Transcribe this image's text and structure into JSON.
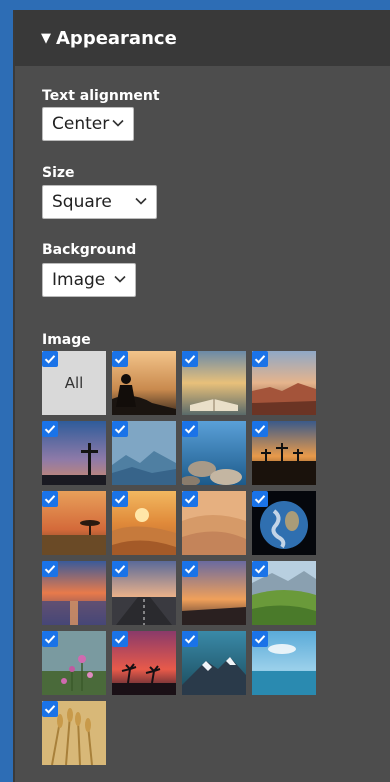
{
  "section": {
    "title": "Appearance"
  },
  "text_alignment": {
    "label": "Text alignment",
    "value": "Center"
  },
  "size": {
    "label": "Size",
    "value": "Square"
  },
  "background": {
    "label": "Background",
    "value": "Image"
  },
  "image": {
    "label": "Image",
    "all_label": "All",
    "tiles": [
      "person-reading-sunset",
      "open-book-lake",
      "red-rock-canyon",
      "cross-dusk",
      "misty-mountains",
      "rocky-coast",
      "three-crosses-sunset",
      "tree-savanna-sunset",
      "desert-dunes-sun",
      "desert-dunes",
      "earth-globe",
      "ocean-sunset",
      "road-horizon",
      "sunset-sky",
      "green-hills",
      "wildflowers",
      "palm-trees-sunset",
      "snowy-mountain",
      "sea-clouds",
      "wheat-field"
    ]
  }
}
